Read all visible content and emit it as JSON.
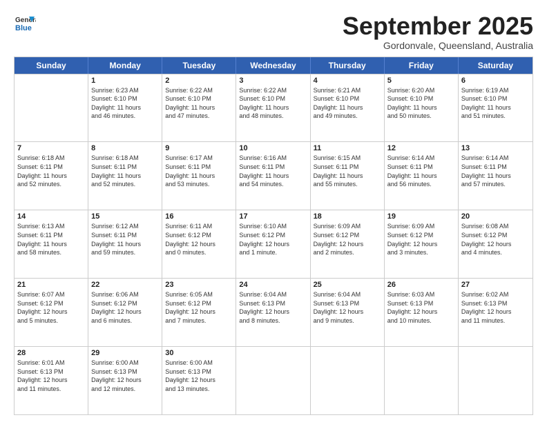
{
  "logo": {
    "general": "General",
    "blue": "Blue"
  },
  "title": "September 2025",
  "location": "Gordonvale, Queensland, Australia",
  "days": [
    "Sunday",
    "Monday",
    "Tuesday",
    "Wednesday",
    "Thursday",
    "Friday",
    "Saturday"
  ],
  "weeks": [
    [
      {
        "day": "",
        "info": ""
      },
      {
        "day": "1",
        "info": "Sunrise: 6:23 AM\nSunset: 6:10 PM\nDaylight: 11 hours\nand 46 minutes."
      },
      {
        "day": "2",
        "info": "Sunrise: 6:22 AM\nSunset: 6:10 PM\nDaylight: 11 hours\nand 47 minutes."
      },
      {
        "day": "3",
        "info": "Sunrise: 6:22 AM\nSunset: 6:10 PM\nDaylight: 11 hours\nand 48 minutes."
      },
      {
        "day": "4",
        "info": "Sunrise: 6:21 AM\nSunset: 6:10 PM\nDaylight: 11 hours\nand 49 minutes."
      },
      {
        "day": "5",
        "info": "Sunrise: 6:20 AM\nSunset: 6:10 PM\nDaylight: 11 hours\nand 50 minutes."
      },
      {
        "day": "6",
        "info": "Sunrise: 6:19 AM\nSunset: 6:10 PM\nDaylight: 11 hours\nand 51 minutes."
      }
    ],
    [
      {
        "day": "7",
        "info": "Sunrise: 6:18 AM\nSunset: 6:11 PM\nDaylight: 11 hours\nand 52 minutes."
      },
      {
        "day": "8",
        "info": "Sunrise: 6:18 AM\nSunset: 6:11 PM\nDaylight: 11 hours\nand 52 minutes."
      },
      {
        "day": "9",
        "info": "Sunrise: 6:17 AM\nSunset: 6:11 PM\nDaylight: 11 hours\nand 53 minutes."
      },
      {
        "day": "10",
        "info": "Sunrise: 6:16 AM\nSunset: 6:11 PM\nDaylight: 11 hours\nand 54 minutes."
      },
      {
        "day": "11",
        "info": "Sunrise: 6:15 AM\nSunset: 6:11 PM\nDaylight: 11 hours\nand 55 minutes."
      },
      {
        "day": "12",
        "info": "Sunrise: 6:14 AM\nSunset: 6:11 PM\nDaylight: 11 hours\nand 56 minutes."
      },
      {
        "day": "13",
        "info": "Sunrise: 6:14 AM\nSunset: 6:11 PM\nDaylight: 11 hours\nand 57 minutes."
      }
    ],
    [
      {
        "day": "14",
        "info": "Sunrise: 6:13 AM\nSunset: 6:11 PM\nDaylight: 11 hours\nand 58 minutes."
      },
      {
        "day": "15",
        "info": "Sunrise: 6:12 AM\nSunset: 6:11 PM\nDaylight: 11 hours\nand 59 minutes."
      },
      {
        "day": "16",
        "info": "Sunrise: 6:11 AM\nSunset: 6:12 PM\nDaylight: 12 hours\nand 0 minutes."
      },
      {
        "day": "17",
        "info": "Sunrise: 6:10 AM\nSunset: 6:12 PM\nDaylight: 12 hours\nand 1 minute."
      },
      {
        "day": "18",
        "info": "Sunrise: 6:09 AM\nSunset: 6:12 PM\nDaylight: 12 hours\nand 2 minutes."
      },
      {
        "day": "19",
        "info": "Sunrise: 6:09 AM\nSunset: 6:12 PM\nDaylight: 12 hours\nand 3 minutes."
      },
      {
        "day": "20",
        "info": "Sunrise: 6:08 AM\nSunset: 6:12 PM\nDaylight: 12 hours\nand 4 minutes."
      }
    ],
    [
      {
        "day": "21",
        "info": "Sunrise: 6:07 AM\nSunset: 6:12 PM\nDaylight: 12 hours\nand 5 minutes."
      },
      {
        "day": "22",
        "info": "Sunrise: 6:06 AM\nSunset: 6:12 PM\nDaylight: 12 hours\nand 6 minutes."
      },
      {
        "day": "23",
        "info": "Sunrise: 6:05 AM\nSunset: 6:12 PM\nDaylight: 12 hours\nand 7 minutes."
      },
      {
        "day": "24",
        "info": "Sunrise: 6:04 AM\nSunset: 6:13 PM\nDaylight: 12 hours\nand 8 minutes."
      },
      {
        "day": "25",
        "info": "Sunrise: 6:04 AM\nSunset: 6:13 PM\nDaylight: 12 hours\nand 9 minutes."
      },
      {
        "day": "26",
        "info": "Sunrise: 6:03 AM\nSunset: 6:13 PM\nDaylight: 12 hours\nand 10 minutes."
      },
      {
        "day": "27",
        "info": "Sunrise: 6:02 AM\nSunset: 6:13 PM\nDaylight: 12 hours\nand 11 minutes."
      }
    ],
    [
      {
        "day": "28",
        "info": "Sunrise: 6:01 AM\nSunset: 6:13 PM\nDaylight: 12 hours\nand 11 minutes."
      },
      {
        "day": "29",
        "info": "Sunrise: 6:00 AM\nSunset: 6:13 PM\nDaylight: 12 hours\nand 12 minutes."
      },
      {
        "day": "30",
        "info": "Sunrise: 6:00 AM\nSunset: 6:13 PM\nDaylight: 12 hours\nand 13 minutes."
      },
      {
        "day": "",
        "info": ""
      },
      {
        "day": "",
        "info": ""
      },
      {
        "day": "",
        "info": ""
      },
      {
        "day": "",
        "info": ""
      }
    ]
  ]
}
